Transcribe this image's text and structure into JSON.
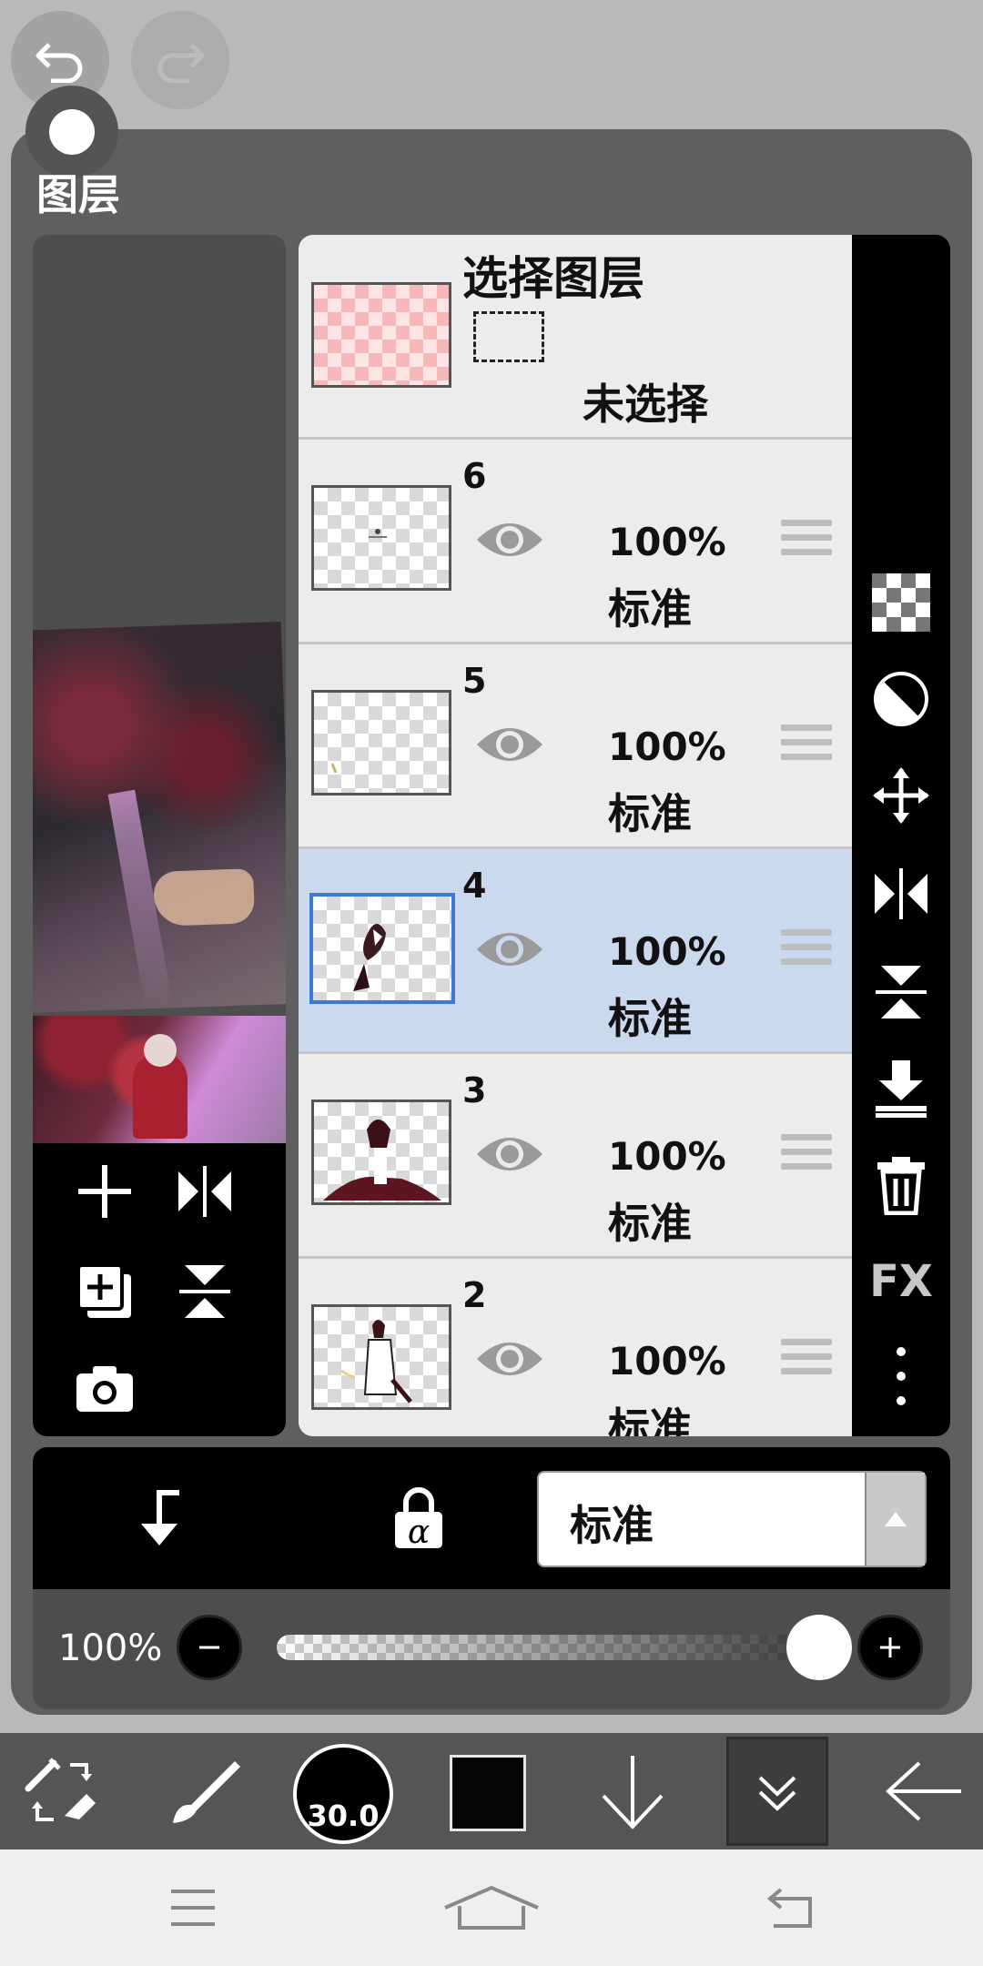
{
  "header": {
    "undo": "undo-icon",
    "redo": "redo-icon"
  },
  "panel": {
    "title": "图层"
  },
  "selection_layer": {
    "title": "选择图层",
    "status": "未选择"
  },
  "layers": [
    {
      "number": "6",
      "opacity": "100%",
      "blend": "标准",
      "selected": false
    },
    {
      "number": "5",
      "opacity": "100%",
      "blend": "标准",
      "selected": false
    },
    {
      "number": "4",
      "opacity": "100%",
      "blend": "标准",
      "selected": true
    },
    {
      "number": "3",
      "opacity": "100%",
      "blend": "标准",
      "selected": false
    },
    {
      "number": "2",
      "opacity": "100%",
      "blend": "标准",
      "selected": false
    }
  ],
  "right_toolbar": {
    "fx_label": "FX"
  },
  "controls": {
    "blend_mode": "标准",
    "opacity_label": "100%",
    "opacity_value": 1.0
  },
  "toolbar": {
    "brush_size": "30.0",
    "color": "#050507"
  },
  "colors": {
    "selected_row": "#cbd9ee",
    "selected_border": "#3a7ad5",
    "panel_bg": "#5f5f5f"
  }
}
